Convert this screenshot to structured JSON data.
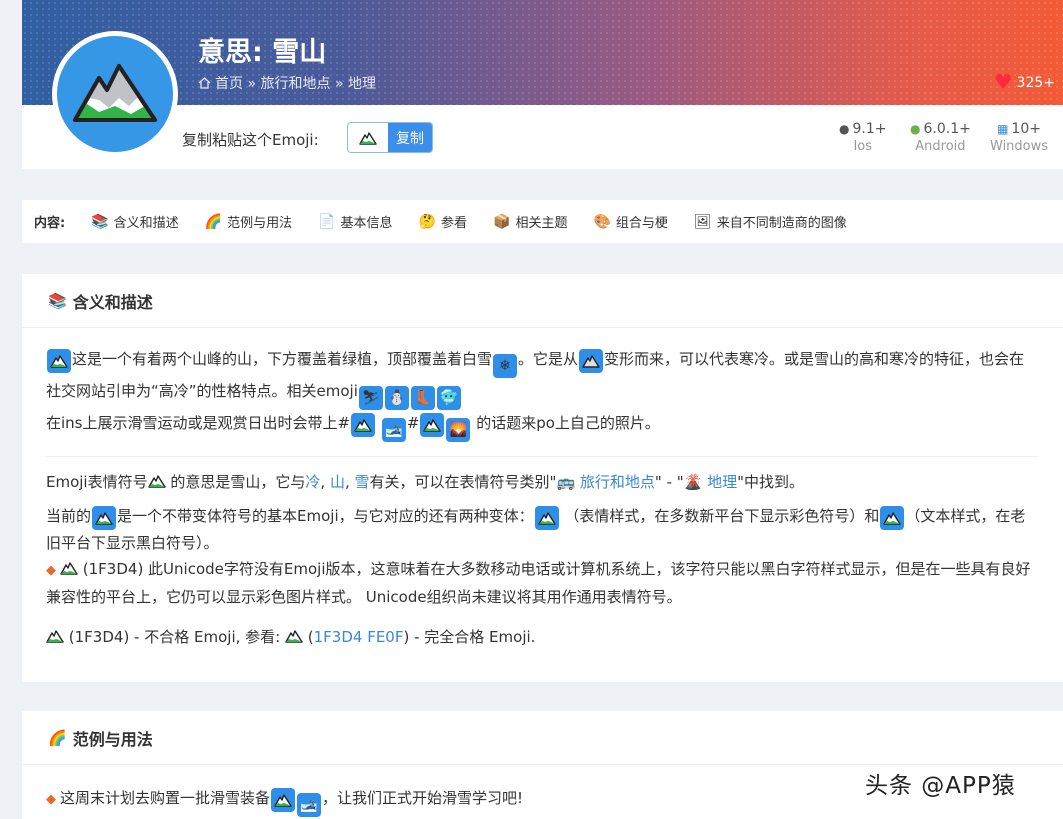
{
  "page": {
    "title": "意思: 雪山",
    "likes": "325+"
  },
  "breadcrumb": {
    "home": "首页",
    "sep1": "»",
    "category": "旅行和地点",
    "sep2": "»",
    "sub": "地理"
  },
  "copy": {
    "label": "复制粘贴这个Emoji:",
    "button": "复制"
  },
  "platforms": [
    {
      "version": "9.1+",
      "name": "Ios",
      "icon": "apple-icon"
    },
    {
      "version": "6.0.1+",
      "name": "Android",
      "icon": "android-icon"
    },
    {
      "version": "10+",
      "name": "Windows",
      "icon": "windows-icon"
    }
  ],
  "toc": {
    "label": "内容:",
    "items": [
      "含义和描述",
      "范例与用法",
      "基本信息",
      "参看",
      "相关主题",
      "组合与梗",
      "来自不同制造商的图像"
    ]
  },
  "section1": {
    "heading": "含义和描述",
    "p1a": "这是一个有着两个山峰的山，下方覆盖着绿植，顶部覆盖着白雪",
    "p1b": "。它是从",
    "p1c": "变形而来，可以代表寒冷。或是雪山的高和寒冷的特征，也会在社交网站引申为“高冷”的性格特点。相关emoji",
    "p1d": "在ins上展示滑雪运动或是观赏日出时会带上#",
    "p1e": "#",
    "p1f": " 的话题来po上自己的照片。",
    "p2a": "Emoji表情符号",
    "p2b": " 的意思是雪山，它与",
    "link_cold": "冷",
    "comma1": ", ",
    "link_mountain": "山",
    "comma2": ", ",
    "link_snow": "雪",
    "p2c": "有关，可以在表情符号类别\"",
    "link_travel": "旅行和地点",
    "p2d": "\" - \"",
    "link_geo": "地理",
    "p2e": "\"中找到。",
    "p3a": "当前的",
    "p3b": "是一个不带变体符号的基本Emoji，与它对应的还有两种变体：",
    "p3c": "（表情样式，在多数新平台下显示彩色符号）和",
    "p3d": "（文本样式，在老旧平台下显示黑白符号）。",
    "p4": "(1F3D4) 此Unicode字符没有Emoji版本，这意味着在大多数移动电话或计算机系统上，该字符只能以黑白字符样式显示，但是在一些具有良好兼容性的平台上，它仍可以显示彩色图片样式。 Unicode组织尚未建议将其用作通用表情符号。",
    "p5a": "(1F3D4) - 不合格 Emoji, 参看:",
    "p5b": "(",
    "link_fe0f": "1F3D4 FE0F",
    "p5c": ") - 完全合格 Emoji."
  },
  "section2": {
    "heading": "范例与用法",
    "line1a": "这周末计划去购置一批滑雪装备",
    "line1b": "，让我们正式开始滑雪学习吧!"
  },
  "watermark": "头条 @APP猿"
}
